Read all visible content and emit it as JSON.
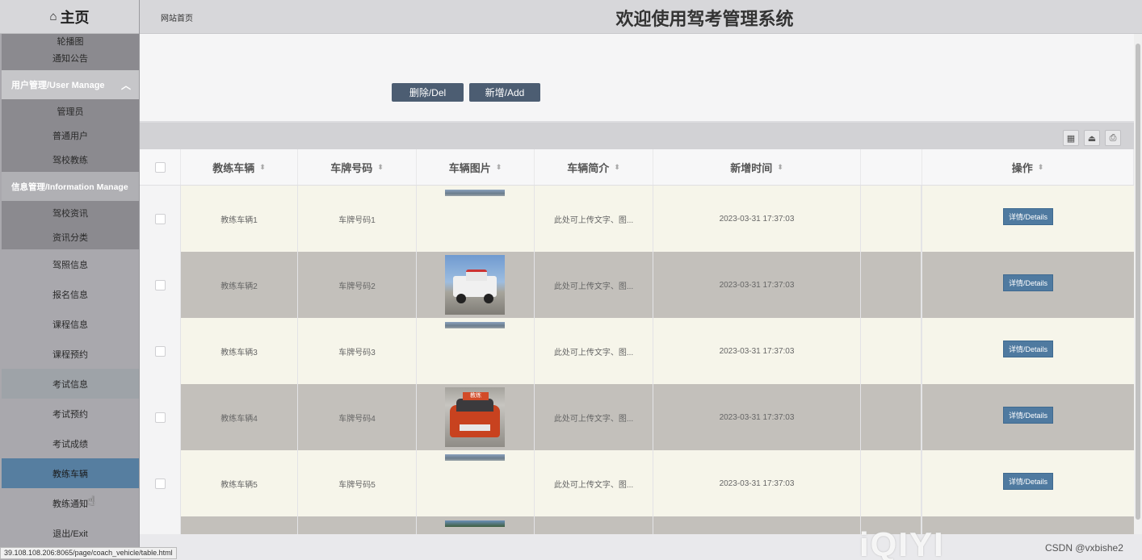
{
  "sidebar": {
    "home_label": "主页",
    "menu": [
      {
        "label": "轮播图",
        "kind": "sub-cut"
      },
      {
        "label": "通知公告",
        "kind": "sub"
      },
      {
        "label": "用户管理/User Manage",
        "kind": "group"
      },
      {
        "label": "管理员",
        "kind": "sub"
      },
      {
        "label": "普通用户",
        "kind": "sub"
      },
      {
        "label": "驾校教练",
        "kind": "sub"
      },
      {
        "label": "信息管理/Information Manage",
        "kind": "group2"
      },
      {
        "label": "驾校资讯",
        "kind": "sub"
      },
      {
        "label": "资讯分类",
        "kind": "sub"
      },
      {
        "label": "驾照信息",
        "kind": "top"
      },
      {
        "label": "报名信息",
        "kind": "top"
      },
      {
        "label": "课程信息",
        "kind": "top"
      },
      {
        "label": "课程预约",
        "kind": "top"
      },
      {
        "label": "考试信息",
        "kind": "top-hl"
      },
      {
        "label": "考试预约",
        "kind": "top"
      },
      {
        "label": "考试成绩",
        "kind": "top"
      },
      {
        "label": "教练车辆",
        "kind": "top-active"
      },
      {
        "label": "教练通知",
        "kind": "top"
      },
      {
        "label": "退出/Exit",
        "kind": "top"
      }
    ]
  },
  "header": {
    "breadcrumb": "网站首页",
    "title": "欢迎使用驾考管理系统"
  },
  "actions": {
    "delete_label": "删除/Del",
    "add_label": "新增/Add"
  },
  "table": {
    "headers": [
      "教练车辆",
      "车牌号码",
      "车辆图片",
      "车辆简介",
      "新增时间",
      "",
      "操作"
    ],
    "detail_label": "详情/Details",
    "rows": [
      {
        "vehicle": "教练车辆1",
        "plate": "车牌号码1",
        "intro": "此处可上传文字、图...",
        "time": "2023-03-31 17:37:03",
        "photo": "strip"
      },
      {
        "vehicle": "教练车辆2",
        "plate": "车牌号码2",
        "intro": "此处可上传文字、图...",
        "time": "2023-03-31 17:37:03",
        "photo": "truck"
      },
      {
        "vehicle": "教练车辆3",
        "plate": "车牌号码3",
        "intro": "此处可上传文字、图...",
        "time": "2023-03-31 17:37:03",
        "photo": "strip"
      },
      {
        "vehicle": "教练车辆4",
        "plate": "车牌号码4",
        "intro": "此处可上传文字、图...",
        "time": "2023-03-31 17:37:03",
        "photo": "car"
      },
      {
        "vehicle": "教练车辆5",
        "plate": "车牌号码5",
        "intro": "此处可上传文字、图...",
        "time": "2023-03-31 17:37:03",
        "photo": "strip"
      }
    ],
    "car_sign_text": "教练"
  },
  "status_bar": {
    "url": "39.108.108.206:8065/page/coach_vehicle/table.html"
  },
  "watermarks": {
    "iqiyi": "iQIYI",
    "csdn": "CSDN @vxbishe2"
  },
  "colors": {
    "accent": "#567ea0",
    "button": "#4c5d72",
    "detail_button": "#4f7aa0"
  }
}
